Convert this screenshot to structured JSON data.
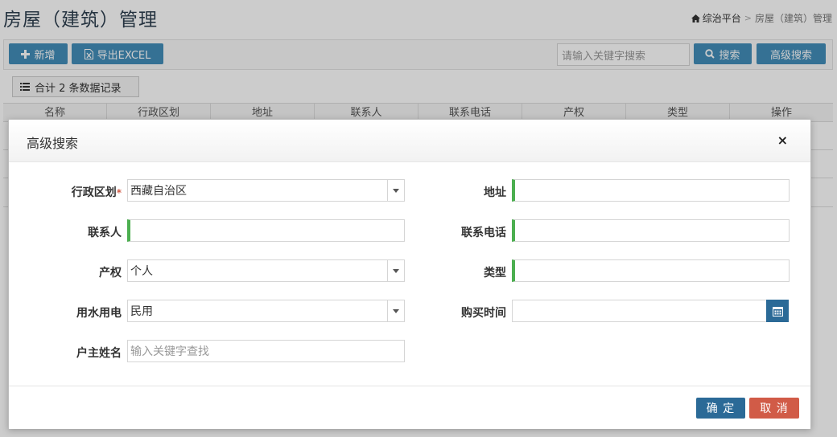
{
  "page": {
    "title": "房屋（建筑）管理",
    "breadcrumb": {
      "home": "综治平台",
      "current": "房屋（建筑）管理"
    }
  },
  "toolbar": {
    "add_label": "新增",
    "export_label": "导出EXCEL",
    "search_placeholder": "请输入关键字搜索",
    "search_label": "搜索",
    "advanced_label": "高级搜索"
  },
  "records": {
    "count_label": "合计 2 条数据记录"
  },
  "table": {
    "columns": [
      "名称",
      "行政区划",
      "地址",
      "联系人",
      "联系电话",
      "产权",
      "类型",
      "操作"
    ]
  },
  "modal": {
    "title": "高级搜索",
    "close": "×",
    "fields": {
      "district": {
        "label": "行政区划",
        "required": "*",
        "value": "西藏自治区"
      },
      "address": {
        "label": "地址",
        "value": ""
      },
      "contact": {
        "label": "联系人",
        "value": ""
      },
      "phone": {
        "label": "联系电话",
        "value": ""
      },
      "ownership": {
        "label": "产权",
        "value": "个人"
      },
      "type": {
        "label": "类型",
        "value": ""
      },
      "utility": {
        "label": "用水用电",
        "value": "民用"
      },
      "purchase_time": {
        "label": "购买时间",
        "value": ""
      },
      "owner_name": {
        "label": "户主姓名",
        "placeholder": "输入关键字查找"
      }
    },
    "confirm_label": "确 定",
    "cancel_label": "取 消"
  },
  "colors": {
    "primary": "#438eb9",
    "primary_dark": "#2b6a97",
    "danger": "#d15b47",
    "valid_green": "#4caf50"
  }
}
